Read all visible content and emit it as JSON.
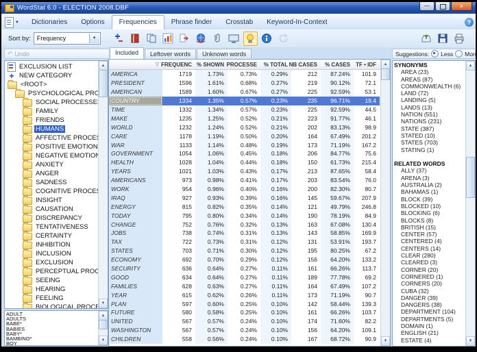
{
  "window": {
    "title": "WordStat 6.0 - ELECTION 2008.DBF"
  },
  "colors": {
    "titlebar_blue": "#2a5ab5",
    "selection_blue": "#4f79d2",
    "tree_selection": "#2f5fc4",
    "word_column_bg": "#d8e8f8",
    "close_button_orange": "#cf5a2a",
    "bulb_highlight": "#fdf0bc"
  },
  "tabs": {
    "active": "Frequencies",
    "items": [
      "Dictionaries",
      "Options",
      "Frequencies",
      "Phrase finder",
      "Crosstab",
      "Keyword-In-Context"
    ]
  },
  "help_label": "?",
  "toolbar": {
    "sort_by_label": "Sort by:",
    "sort_by_value": "Frequency",
    "icons": [
      {
        "name": "add-words"
      },
      {
        "name": "dictionary"
      },
      {
        "name": "copy"
      },
      {
        "name": "chart"
      },
      {
        "name": "export"
      },
      {
        "name": "speak"
      },
      {
        "name": "attach"
      },
      {
        "name": "display"
      },
      {
        "name": "bulb",
        "active": true
      },
      {
        "name": "info"
      },
      {
        "name": "refresh",
        "disabled": true
      }
    ],
    "right_icons": [
      {
        "name": "load"
      },
      {
        "name": "save"
      },
      {
        "name": "print"
      }
    ]
  },
  "tree": {
    "undo_label": "Undo",
    "selected": "HUMANS",
    "items": [
      {
        "level": 0,
        "icon": "exclusion",
        "label": "EXCLUSION LIST"
      },
      {
        "level": 0,
        "icon": "plus",
        "label": "NEW CATEGORY"
      },
      {
        "level": 0,
        "icon": "folder-open",
        "label": "<ROOT>"
      },
      {
        "level": 1,
        "icon": "folder-open",
        "label": "PSYCHOLOGICAL PROCESSES"
      },
      {
        "level": 2,
        "icon": "folder",
        "label": "SOCIAL PROCESSES"
      },
      {
        "level": 2,
        "icon": "folder",
        "label": "FAMILY"
      },
      {
        "level": 2,
        "icon": "folder",
        "label": "FRIENDS"
      },
      {
        "level": 2,
        "icon": "folder",
        "label": "HUMANS"
      },
      {
        "level": 2,
        "icon": "folder",
        "label": "AFFECTIVE PROCESSES"
      },
      {
        "level": 2,
        "icon": "folder",
        "label": "POSITIVE EMOTION"
      },
      {
        "level": 2,
        "icon": "folder",
        "label": "NEGATIVE EMOTION"
      },
      {
        "level": 2,
        "icon": "folder",
        "label": "ANXIETY"
      },
      {
        "level": 2,
        "icon": "folder",
        "label": "ANGER"
      },
      {
        "level": 2,
        "icon": "folder",
        "label": "SADNESS"
      },
      {
        "level": 2,
        "icon": "folder",
        "label": "COGNITIVE PROCESSES"
      },
      {
        "level": 2,
        "icon": "folder",
        "label": "INSIGHT"
      },
      {
        "level": 2,
        "icon": "folder",
        "label": "CAUSATION"
      },
      {
        "level": 2,
        "icon": "folder",
        "label": "DISCREPANCY"
      },
      {
        "level": 2,
        "icon": "folder",
        "label": "TENTATIVENESS"
      },
      {
        "level": 2,
        "icon": "folder",
        "label": "CERTAINTY"
      },
      {
        "level": 2,
        "icon": "folder",
        "label": "INHIBITION"
      },
      {
        "level": 2,
        "icon": "folder",
        "label": "INCLUSION"
      },
      {
        "level": 2,
        "icon": "folder",
        "label": "EXCLUSION"
      },
      {
        "level": 2,
        "icon": "folder",
        "label": "PERCEPTUAL PROCESSES"
      },
      {
        "level": 2,
        "icon": "folder",
        "label": "SEEING"
      },
      {
        "level": 2,
        "icon": "folder",
        "label": "HEARING"
      },
      {
        "level": 2,
        "icon": "folder",
        "label": "FEELING"
      },
      {
        "level": 2,
        "icon": "folder",
        "label": "BIOLOGICAL PROCESSES"
      }
    ]
  },
  "word_list": {
    "items": [
      "ADULT",
      "ADULTS",
      "BABE*",
      "BABIES",
      "BABY*",
      "BAMBINO*",
      "BOY"
    ]
  },
  "subtabs": {
    "active": "Included",
    "items": [
      "Included",
      "Leftover words",
      "Unknown words"
    ]
  },
  "table": {
    "sort_column": "FREQUENC",
    "selected_word": "COUNTRY",
    "columns": [
      "",
      "FREQUENC",
      "% SHOWN",
      "PROCESSE",
      "% TOTAL",
      "NB CASES",
      "% CASES",
      "TF • IDF"
    ],
    "rows": [
      [
        "AMERICA",
        "1719",
        "1.73%",
        "0.73%",
        "0.29%",
        "212",
        "87.24%",
        "101.9"
      ],
      [
        "PRESIDENT",
        "1596",
        "1.61%",
        "0.68%",
        "0.27%",
        "219",
        "90.12%",
        "72.1"
      ],
      [
        "AMERICAN",
        "1589",
        "1.60%",
        "0.67%",
        "0.27%",
        "225",
        "92.59%",
        "53.1"
      ],
      [
        "COUNTRY",
        "1334",
        "1.35%",
        "0.57%",
        "0.23%",
        "235",
        "96.71%",
        "19.4"
      ],
      [
        "TIME",
        "1332",
        "1.34%",
        "0.57%",
        "0.23%",
        "225",
        "92.59%",
        "44.5"
      ],
      [
        "MAKE",
        "1235",
        "1.25%",
        "0.52%",
        "0.21%",
        "223",
        "91.77%",
        "46.1"
      ],
      [
        "WORLD",
        "1232",
        "1.24%",
        "0.52%",
        "0.21%",
        "202",
        "83.13%",
        "98.9"
      ],
      [
        "CARE",
        "1178",
        "1.19%",
        "0.50%",
        "0.20%",
        "164",
        "67.49%",
        "201.2"
      ],
      [
        "WAR",
        "1133",
        "1.14%",
        "0.48%",
        "0.19%",
        "173",
        "71.19%",
        "167.2"
      ],
      [
        "GOVERNMENT",
        "1054",
        "1.06%",
        "0.45%",
        "0.18%",
        "206",
        "84.77%",
        "75.6"
      ],
      [
        "HEALTH",
        "1028",
        "1.04%",
        "0.44%",
        "0.18%",
        "150",
        "61.73%",
        "215.4"
      ],
      [
        "YEARS",
        "1021",
        "1.03%",
        "0.43%",
        "0.17%",
        "213",
        "87.65%",
        "58.4"
      ],
      [
        "AMERICANS",
        "973",
        "0.98%",
        "0.41%",
        "0.17%",
        "203",
        "83.54%",
        "76.0"
      ],
      [
        "WORK",
        "954",
        "0.96%",
        "0.40%",
        "0.16%",
        "200",
        "82.30%",
        "80.7"
      ],
      [
        "IRAQ",
        "927",
        "0.93%",
        "0.39%",
        "0.16%",
        "145",
        "59.67%",
        "207.9"
      ],
      [
        "ENERGY",
        "815",
        "0.82%",
        "0.35%",
        "0.14%",
        "121",
        "49.79%",
        "246.8"
      ],
      [
        "TODAY",
        "795",
        "0.80%",
        "0.34%",
        "0.14%",
        "190",
        "78.19%",
        "84.9"
      ],
      [
        "CHANGE",
        "752",
        "0.76%",
        "0.32%",
        "0.13%",
        "163",
        "67.08%",
        "130.4"
      ],
      [
        "JOBS",
        "738",
        "0.74%",
        "0.31%",
        "0.13%",
        "143",
        "58.85%",
        "169.9"
      ],
      [
        "TAX",
        "722",
        "0.73%",
        "0.31%",
        "0.12%",
        "131",
        "53.91%",
        "193.7"
      ],
      [
        "STATES",
        "703",
        "0.71%",
        "0.30%",
        "0.12%",
        "195",
        "80.25%",
        "67.2"
      ],
      [
        "ECONOMY",
        "692",
        "0.70%",
        "0.29%",
        "0.12%",
        "156",
        "64.20%",
        "133.2"
      ],
      [
        "SECURITY",
        "636",
        "0.64%",
        "0.27%",
        "0.11%",
        "161",
        "66.26%",
        "113.7"
      ],
      [
        "GOOD",
        "634",
        "0.64%",
        "0.27%",
        "0.11%",
        "189",
        "77.78%",
        "69.2"
      ],
      [
        "FAMILIES",
        "628",
        "0.63%",
        "0.27%",
        "0.11%",
        "164",
        "67.49%",
        "107.2"
      ],
      [
        "YEAR",
        "615",
        "0.62%",
        "0.26%",
        "0.11%",
        "173",
        "71.19%",
        "90.7"
      ],
      [
        "PLAN",
        "597",
        "0.60%",
        "0.25%",
        "0.10%",
        "142",
        "58.44%",
        "139.3"
      ],
      [
        "FUTURE",
        "580",
        "0.58%",
        "0.25%",
        "0.10%",
        "161",
        "66.26%",
        "103.7"
      ],
      [
        "UNITED",
        "567",
        "0.57%",
        "0.24%",
        "0.10%",
        "174",
        "71.60%",
        "82.2"
      ],
      [
        "WASHINGTON",
        "567",
        "0.57%",
        "0.24%",
        "0.10%",
        "156",
        "64.20%",
        "109.1"
      ],
      [
        "CHILDREN",
        "558",
        "0.56%",
        "0.24%",
        "0.10%",
        "167",
        "68.72%",
        "90.9"
      ]
    ]
  },
  "suggestions": {
    "label": "Suggestions:",
    "less_label": "Less",
    "more_label": "More",
    "selected_option": "Less",
    "sections": [
      {
        "title": "SYNONYMS",
        "items": [
          "AREA (23)",
          "AREAS (87)",
          "COMMONWEALTH (6)",
          "LAND (72)",
          "LANDING (5)",
          "LANDS (13)",
          "NATION (551)",
          "NATIONS (231)",
          "STATE (387)",
          "STATED (10)",
          "STATES (703)",
          "STATING (1)"
        ]
      },
      {
        "title": "RELATED WORDS",
        "items": [
          "ALLY (37)",
          "ARENA (3)",
          "AUSTRALIA (2)",
          "BAHAMAS (1)",
          "BLOCK (39)",
          "BLOCKED (10)",
          "BLOCKING (6)",
          "BLOCKS (8)",
          "BRITISH (15)",
          "CENTER (57)",
          "CENTERED (4)",
          "CENTERS (14)",
          "CLEAR (280)",
          "CLEARED (3)",
          "CORNER (20)",
          "CORNERED (1)",
          "CORNERS (20)",
          "CUBA (32)",
          "DANGER (39)",
          "DANGERS (38)",
          "DEPARTMENT (104)",
          "DEPARTMENTS (5)",
          "DOMAIN (1)",
          "ENGLISH (21)",
          "ESTATE (4)"
        ]
      }
    ]
  }
}
